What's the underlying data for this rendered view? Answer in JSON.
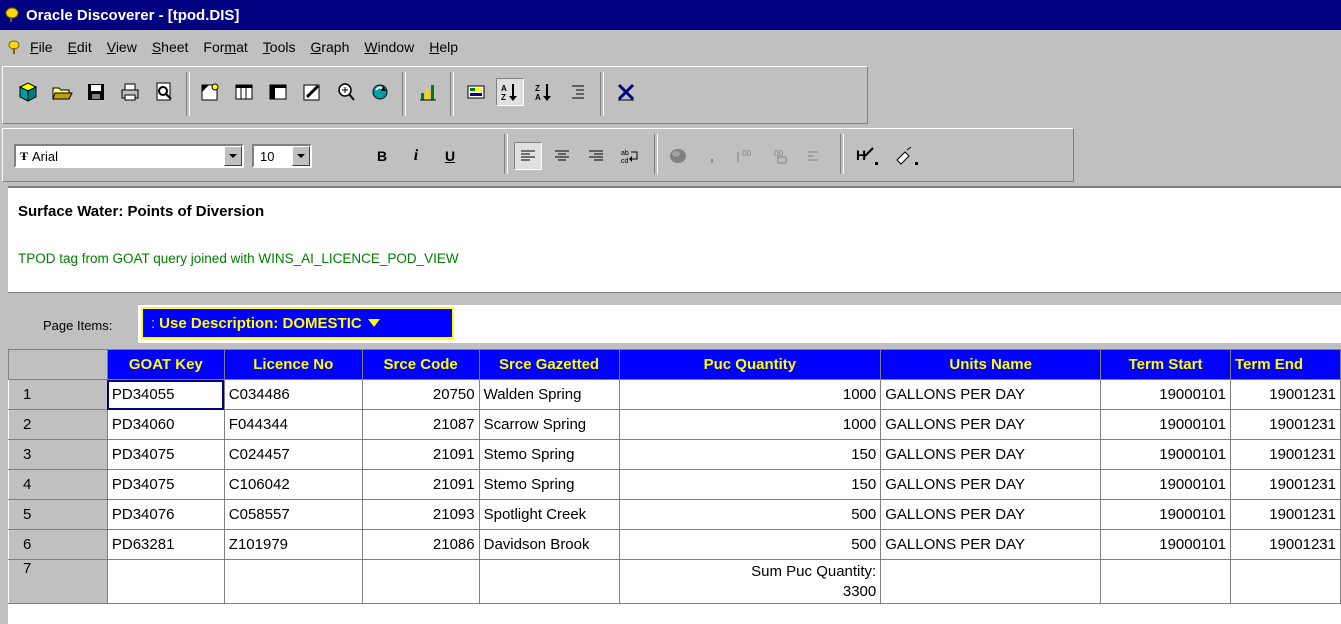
{
  "window": {
    "title": "Oracle Discoverer - [tpod.DIS]"
  },
  "menu": {
    "items": [
      {
        "label": "File",
        "u": "F"
      },
      {
        "label": "Edit",
        "u": "E"
      },
      {
        "label": "View",
        "u": "V"
      },
      {
        "label": "Sheet",
        "u": "S"
      },
      {
        "label": "Format",
        "u": "m"
      },
      {
        "label": "Tools",
        "u": "T"
      },
      {
        "label": "Graph",
        "u": "G"
      },
      {
        "label": "Window",
        "u": "W"
      },
      {
        "label": "Help",
        "u": "H"
      }
    ]
  },
  "toolbar_format": {
    "font_value": "Arial",
    "font_icon": "TrueType",
    "size_value": "10",
    "bold_label": "B",
    "italic_label": "i",
    "underline_label": "U"
  },
  "worksheet": {
    "title": "Surface Water:  Points of Diversion",
    "subtitle": "TPOD tag from GOAT query joined with WINS_AI_LICENCE_POD_VIEW",
    "page_items_label": "Page Items:",
    "page_item_value": "Use Description: DOMESTIC"
  },
  "table": {
    "columns": [
      "GOAT Key",
      "Licence No",
      "Srce Code",
      "Srce Gazetted",
      "Puc Quantity",
      "Units Name",
      "Term Start",
      "Term End"
    ],
    "rows": [
      {
        "n": "1",
        "cells": [
          "PD34055",
          "C034486",
          "20750",
          "Walden Spring",
          "1000",
          "GALLONS PER DAY",
          "19000101",
          "19001231"
        ]
      },
      {
        "n": "2",
        "cells": [
          "PD34060",
          "F044344",
          "21087",
          "Scarrow Spring",
          "1000",
          "GALLONS PER DAY",
          "19000101",
          "19001231"
        ]
      },
      {
        "n": "3",
        "cells": [
          "PD34075",
          "C024457",
          "21091",
          "Stemo Spring",
          "150",
          "GALLONS PER DAY",
          "19000101",
          "19001231"
        ]
      },
      {
        "n": "4",
        "cells": [
          "PD34075",
          "C106042",
          "21091",
          "Stemo Spring",
          "150",
          "GALLONS PER DAY",
          "19000101",
          "19001231"
        ]
      },
      {
        "n": "5",
        "cells": [
          "PD34076",
          "C058557",
          "21093",
          "Spotlight Creek",
          "500",
          "GALLONS PER DAY",
          "19000101",
          "19001231"
        ]
      },
      {
        "n": "6",
        "cells": [
          "PD63281",
          "Z101979",
          "21086",
          "Davidson Brook",
          "500",
          "GALLONS PER DAY",
          "19000101",
          "19001231"
        ]
      }
    ],
    "total_row": {
      "n": "7",
      "sum_label": "Sum Puc Quantity:",
      "sum_value": "3300"
    }
  },
  "colors": {
    "header_bg": "#0000ff",
    "header_text": "#ffff00",
    "title_bar": "#000080",
    "subtitle": "#008000"
  }
}
